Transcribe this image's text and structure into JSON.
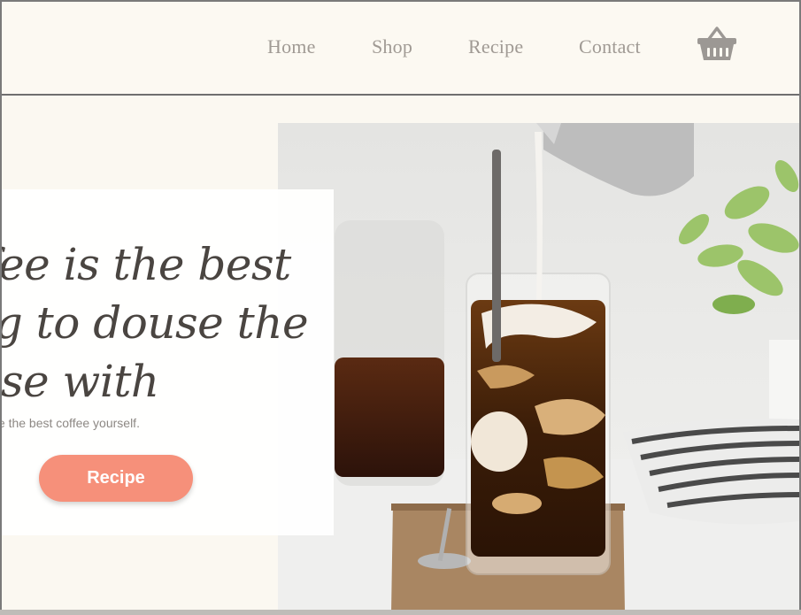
{
  "nav": {
    "links": [
      {
        "label": "Home"
      },
      {
        "label": "Shop"
      },
      {
        "label": "Recipe"
      },
      {
        "label": "Contact"
      }
    ],
    "cart_icon": "basket-icon"
  },
  "hero": {
    "headline_lines": [
      "ffee is the best",
      "ng to douse the",
      "rise with"
    ],
    "subtext": "te the best coffee yourself.",
    "cta_label": "Recipe",
    "image_subject": "iced-coffee-with-milk-pour"
  },
  "colors": {
    "page_bg": "#fbf8f1",
    "accent": "#f6907a",
    "nav_text": "#a09a94",
    "headline_text": "#4a4541"
  }
}
